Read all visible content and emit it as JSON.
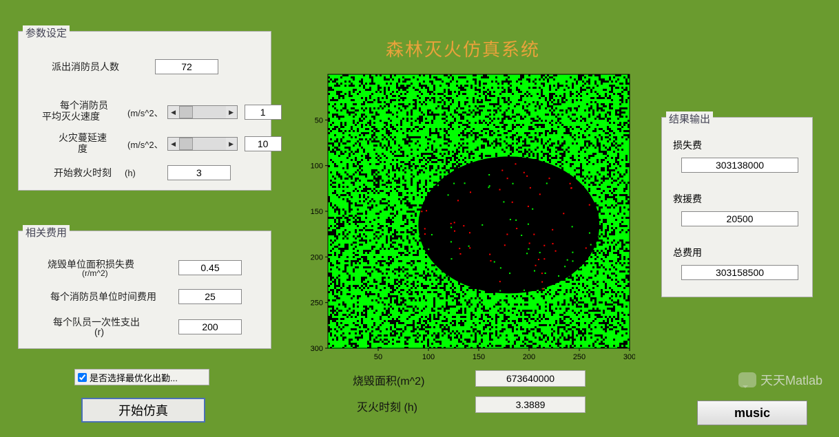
{
  "title": "森林灭火仿真系统",
  "param_panel": {
    "title": "参数设定",
    "fields": {
      "firefighters_label": "派出消防员人数",
      "firefighters_value": "72",
      "per_ff_speed_label_1": "每个消防员",
      "per_ff_speed_label_2": "平均灭火速度",
      "per_ff_speed_unit": "(m/s^2、",
      "per_ff_speed_value": "1",
      "fire_spread_label_1": "火灾蔓延速",
      "fire_spread_label_2": "度",
      "fire_spread_unit": "(m/s^2、",
      "fire_spread_value": "10",
      "start_time_label": "开始救火时刻",
      "start_time_unit": "(h)",
      "start_time_value": "3"
    }
  },
  "cost_panel": {
    "title": "相关费用",
    "fields": {
      "area_loss_label": "烧毁单位面积损失费",
      "area_loss_unit": "(r/m^2)",
      "area_loss_value": "0.45",
      "per_ff_time_label": "每个消防员单位时间费用",
      "per_ff_time_value": "25",
      "oneoff_label_1": "每个队员一次性支出",
      "oneoff_label_2": "(r)",
      "oneoff_value": "200"
    }
  },
  "optimize_checkbox": {
    "label": "是否选择最优化出勤...",
    "checked": true
  },
  "start_button": "开始仿真",
  "chart_data": {
    "type": "heatmap",
    "title": "",
    "xlabel": "",
    "ylabel": "",
    "x_range": [
      0,
      300
    ],
    "y_range": [
      0,
      300
    ],
    "x_ticks": [
      50,
      100,
      150,
      200,
      250,
      300
    ],
    "y_ticks": [
      50,
      100,
      150,
      200,
      250,
      300
    ],
    "grid_size": [
      300,
      300
    ],
    "states": {
      "forest": {
        "color": "#00ff00",
        "approx_fraction": 0.7
      },
      "burned_region": {
        "color": "#000000",
        "shape": "ellipse",
        "center_x": 180,
        "center_y": 165,
        "radius_x": 90,
        "radius_y": 75
      },
      "background_noise": {
        "color": "#000000",
        "approx_fraction": 0.3
      },
      "sparks": {
        "colors": [
          "#ff0000",
          "#00ff00"
        ],
        "location": "inside_burned_region",
        "approx_fraction": 0.01
      }
    }
  },
  "readouts": {
    "area": {
      "label": "烧毁面积(m^2)",
      "value": "673640000"
    },
    "time": {
      "label": "灭火时刻  (h)",
      "value": "3.3889"
    }
  },
  "output_panel": {
    "title": "结果输出",
    "loss_label": "损失费",
    "loss_value": "303138000",
    "rescue_label": "救援费",
    "rescue_value": "20500",
    "total_label": "总费用",
    "total_value": "303158500"
  },
  "music_button": "music",
  "watermark": "天天Matlab"
}
